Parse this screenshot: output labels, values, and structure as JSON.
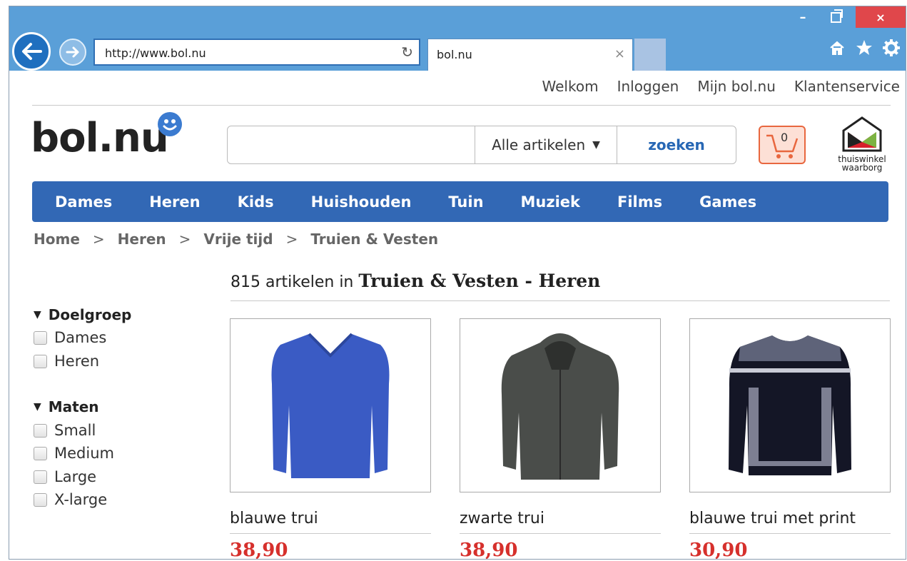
{
  "browser": {
    "url": "http://www.bol.nu",
    "tab_title": "bol.nu",
    "close_symbol": "×",
    "minimize_symbol": "–"
  },
  "toplinks": [
    "Welkom",
    "Inloggen",
    "Mijn bol.nu",
    "Klantenservice"
  ],
  "logo": "bol.nu",
  "search": {
    "value": "",
    "category": "Alle artikelen",
    "button": "zoeken"
  },
  "cart": {
    "count": "0"
  },
  "guarantee": {
    "line1": "thuiswinkel",
    "line2": "waarborg"
  },
  "nav": [
    "Dames",
    "Heren",
    "Kids",
    "Huishouden",
    "Tuin",
    "Muziek",
    "Films",
    "Games"
  ],
  "breadcrumb": [
    "Home",
    "Heren",
    "Vrije tijd",
    "Truien & Vesten"
  ],
  "breadcrumb_sep": ">",
  "results": {
    "prefix": "815 artikelen in",
    "category": "Truien & Vesten - Heren"
  },
  "facets": [
    {
      "title": "Doelgroep",
      "options": [
        "Dames",
        "Heren"
      ]
    },
    {
      "title": "Maten",
      "options": [
        "Small",
        "Medium",
        "Large",
        "X-large"
      ]
    }
  ],
  "products": [
    {
      "name": "blauwe trui",
      "price": "38,90",
      "color": "#3a5bc4"
    },
    {
      "name": "zwarte trui",
      "price": "38,90",
      "color": "#4a4d4a"
    },
    {
      "name": "blauwe trui met print",
      "price": "30,90",
      "color": "#141626"
    }
  ],
  "colors": {
    "nav": "#3268b5",
    "price": "#d6302c",
    "chrome": "#5a9fd8"
  }
}
